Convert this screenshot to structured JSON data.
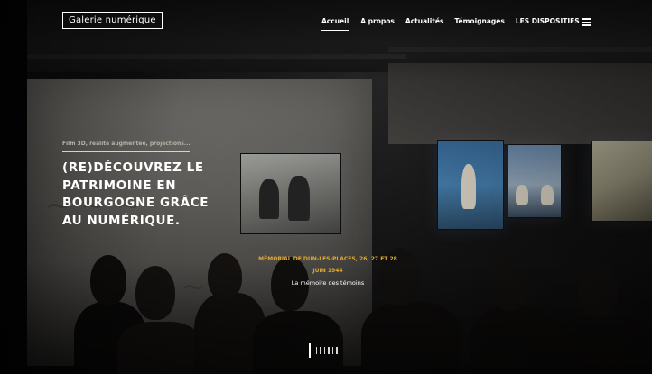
{
  "header": {
    "logo_text": "Galerie numérique",
    "nav": [
      {
        "label": "Accueil",
        "active": true
      },
      {
        "label": "A propos",
        "active": false
      },
      {
        "label": "Actualités",
        "active": false
      },
      {
        "label": "Témoignages",
        "active": false
      },
      {
        "label": "LES DISPOSITIFS",
        "active": false
      }
    ],
    "menu_icon": "hamburger-menu-icon"
  },
  "hero": {
    "kicker": "Film 3D, réalité augmentée, projections...",
    "headline_lines": [
      "(RE)DÉCOUVREZ LE",
      "PATRIMOINE EN",
      "BOURGOGNE GRÂCE",
      "AU NUMÉRIQUE."
    ]
  },
  "caption": {
    "title_lines": [
      "MÉMORIAL DE DUN-LES-PLACES, 26, 27 ET 28",
      "JUIN 1944"
    ],
    "subtitle": "La mémoire des témoins"
  },
  "pager": {
    "total": 7,
    "active_index": 0
  },
  "colors": {
    "accent": "#e2a72e",
    "text": "#ffffff",
    "kicker": "#b9b2a6"
  }
}
